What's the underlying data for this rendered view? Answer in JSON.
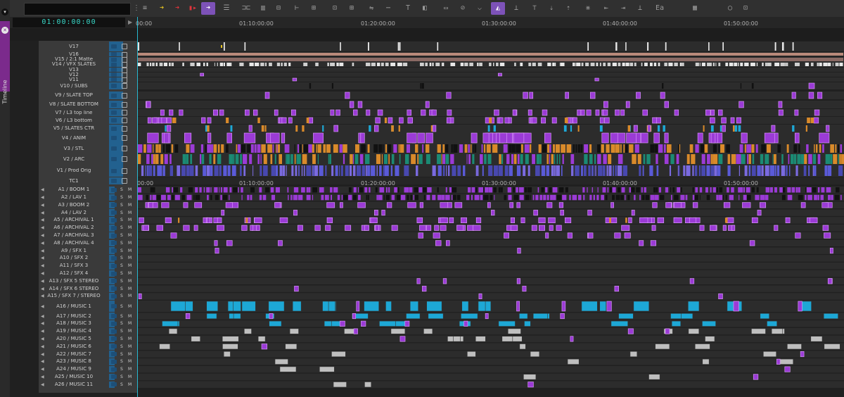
{
  "panel": {
    "tab_label": "Timeline"
  },
  "timecode": {
    "current": "01:00:00:00"
  },
  "ruler": {
    "labels": [
      "00:00",
      "01:10:00:00",
      "01:20:00:00",
      "01:30:00:00",
      "01:40:00:00",
      "01:50:00:00"
    ],
    "labels_short": [
      "00:00",
      "01:10:00:00",
      "01:20:00:00",
      "01:30:00:00",
      "01:40:00:00",
      "01:50:00:00"
    ]
  },
  "timecode_track": {
    "name": "TC1",
    "labels": [
      "00:00",
      "01:10:00:00",
      "01:20:00:00",
      "01:30:00:00",
      "01:40:00:00",
      "01:50:00:00"
    ]
  },
  "toolbar": {
    "effect_label": "Ea"
  },
  "video_tracks": [
    {
      "name": "V17"
    },
    {
      "name": "V16"
    },
    {
      "name": "V15 / 2:1 Matte"
    },
    {
      "name": "V14 / VFX SLATES"
    },
    {
      "name": "V13"
    },
    {
      "name": "V12"
    },
    {
      "name": "V11"
    },
    {
      "name": "V10 / SUBS"
    },
    {
      "name": "V9 / SLATE TOP"
    },
    {
      "name": "V8 / SLATE BOTTOM"
    },
    {
      "name": "V7 / L3 top line"
    },
    {
      "name": "V6 / L3 bottom"
    },
    {
      "name": "V5 / SLATES CTR"
    },
    {
      "name": "V4 / ANIM"
    },
    {
      "name": "V3 / STL"
    },
    {
      "name": "V2 / ARC"
    },
    {
      "name": "V1 / Prod Orig"
    }
  ],
  "audio_tracks": [
    {
      "name": "A1 / BOOM 1"
    },
    {
      "name": "A2 / LAV 1"
    },
    {
      "name": "A3 / BOOM 2"
    },
    {
      "name": "A4 / LAV 2"
    },
    {
      "name": "A5 / ARCHIVAL 1"
    },
    {
      "name": "A6 / ARCHIVAL 2"
    },
    {
      "name": "A7 / ARCHIVAL 3"
    },
    {
      "name": "A8 / ARCHIVAL 4"
    },
    {
      "name": "A9 / SFX 1"
    },
    {
      "name": "A10 / SFX 2"
    },
    {
      "name": "A11 / SFX 3"
    },
    {
      "name": "A12 / SFX 4"
    },
    {
      "name": "A13 / SFX 5 STEREO"
    },
    {
      "name": "A14 / SFX 6 STEREO"
    },
    {
      "name": "A15 / SFX 7 / STEREO"
    },
    {
      "name": "A16 / MUSIC 1"
    },
    {
      "name": "A17 / MUSIC 2"
    },
    {
      "name": "A18 / MUSIC 3"
    },
    {
      "name": "A19 / MUSIC 4"
    },
    {
      "name": "A20 / MUSIC 5"
    },
    {
      "name": "A21 / MUSIC 6"
    },
    {
      "name": "A22 / MUSIC 7"
    },
    {
      "name": "A23 / MUSIC 8"
    },
    {
      "name": "A24 / MUSIC 9"
    },
    {
      "name": "A25 / MUSIC 10"
    },
    {
      "name": "A26 / MUSIC 11"
    }
  ],
  "audio_buttons": {
    "solo": "S",
    "mute": "M"
  },
  "colors": {
    "clip_purple": "#9b3bd6",
    "clip_orange": "#d98a2a",
    "clip_teal": "#1b8a74",
    "clip_blue": "#5a5ad8",
    "clip_cyan": "#1da8d6",
    "clip_white": "#e8e8e8",
    "playhead": "#27b8d0",
    "track_select": "#22618f",
    "tab_purple": "#7b2a8c"
  }
}
